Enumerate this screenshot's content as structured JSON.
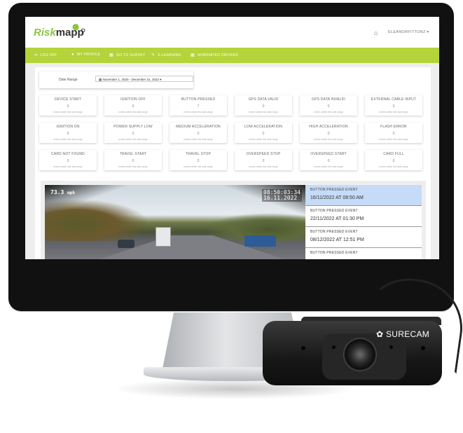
{
  "header": {
    "logo_part1": "Risk",
    "logo_part2": "mapp",
    "user": "ELEANORFITTONZ ▾"
  },
  "nav": [
    {
      "icon": "logout-icon",
      "glyph": "⇥",
      "label": "LOG OFF"
    },
    {
      "icon": "user-icon",
      "glyph": "●",
      "label": "MY PROFILE"
    },
    {
      "icon": "survey-icon",
      "glyph": "▦",
      "label": "GO TO SURVEY"
    },
    {
      "icon": "elearning-icon",
      "glyph": "✎",
      "label": "E-LEARNING"
    },
    {
      "icon": "report-icon",
      "glyph": "▦",
      "label": "NOMINATED DRIVERS"
    }
  ],
  "date_range": {
    "label": "Date Range",
    "value": "▦ November 1, 2020 - December 31, 2022 ▾"
  },
  "cards_subtext": "events within this date range",
  "cards": [
    {
      "title": "DEVICE START",
      "value": "0"
    },
    {
      "title": "IGNITION OFF",
      "value": "0"
    },
    {
      "title": "BUTTON PRESSED",
      "value": "7"
    },
    {
      "title": "GPS DATA VALID",
      "value": "0"
    },
    {
      "title": "GPS DATA INVALID",
      "value": "0"
    },
    {
      "title": "EXTERNAL CABLE INPUT",
      "value": "0"
    },
    {
      "title": "IGNITION ON",
      "value": "0"
    },
    {
      "title": "POWER SUPPLY LOW",
      "value": "0"
    },
    {
      "title": "MEDIUM ACCELERATION",
      "value": "0"
    },
    {
      "title": "LOW ACCELERATION",
      "value": "0"
    },
    {
      "title": "HIGH ACCELERATION",
      "value": "0"
    },
    {
      "title": "FLASH ERROR",
      "value": "0"
    },
    {
      "title": "CARD NOT FOUND",
      "value": "0"
    },
    {
      "title": "TRAVEL START",
      "value": "0"
    },
    {
      "title": "TRAVEL STOP",
      "value": "0"
    },
    {
      "title": "OVERSPEED STOP",
      "value": "0"
    },
    {
      "title": "OVERSPEED START",
      "value": "0"
    },
    {
      "title": "CARD FULL",
      "value": "0"
    }
  ],
  "video": {
    "speed_value": "73.3",
    "speed_unit": "mph",
    "time": "08:50:03:34",
    "date": "16.11.2022"
  },
  "events": [
    {
      "title": "BUTTON PRESSED EVENT",
      "datetime": "16/11/2022 AT 08:50 AM",
      "selected": true
    },
    {
      "title": "BUTTON PRESSED EVENT",
      "datetime": "22/11/2022 AT 01:30 PM",
      "selected": false
    },
    {
      "title": "BUTTON PRESSED EVENT",
      "datetime": "08/12/2022 AT 12:51 PM",
      "selected": false
    },
    {
      "title": "BUTTON PRESSED EVENT",
      "datetime": "",
      "selected": false
    }
  ],
  "device": {
    "brand": "SURECAM",
    "brand_icon": "surecam-logo-icon"
  },
  "colors": {
    "accent": "#b5d33a",
    "logo_green": "#8cc63f",
    "selected_event": "#c5dbf7"
  }
}
